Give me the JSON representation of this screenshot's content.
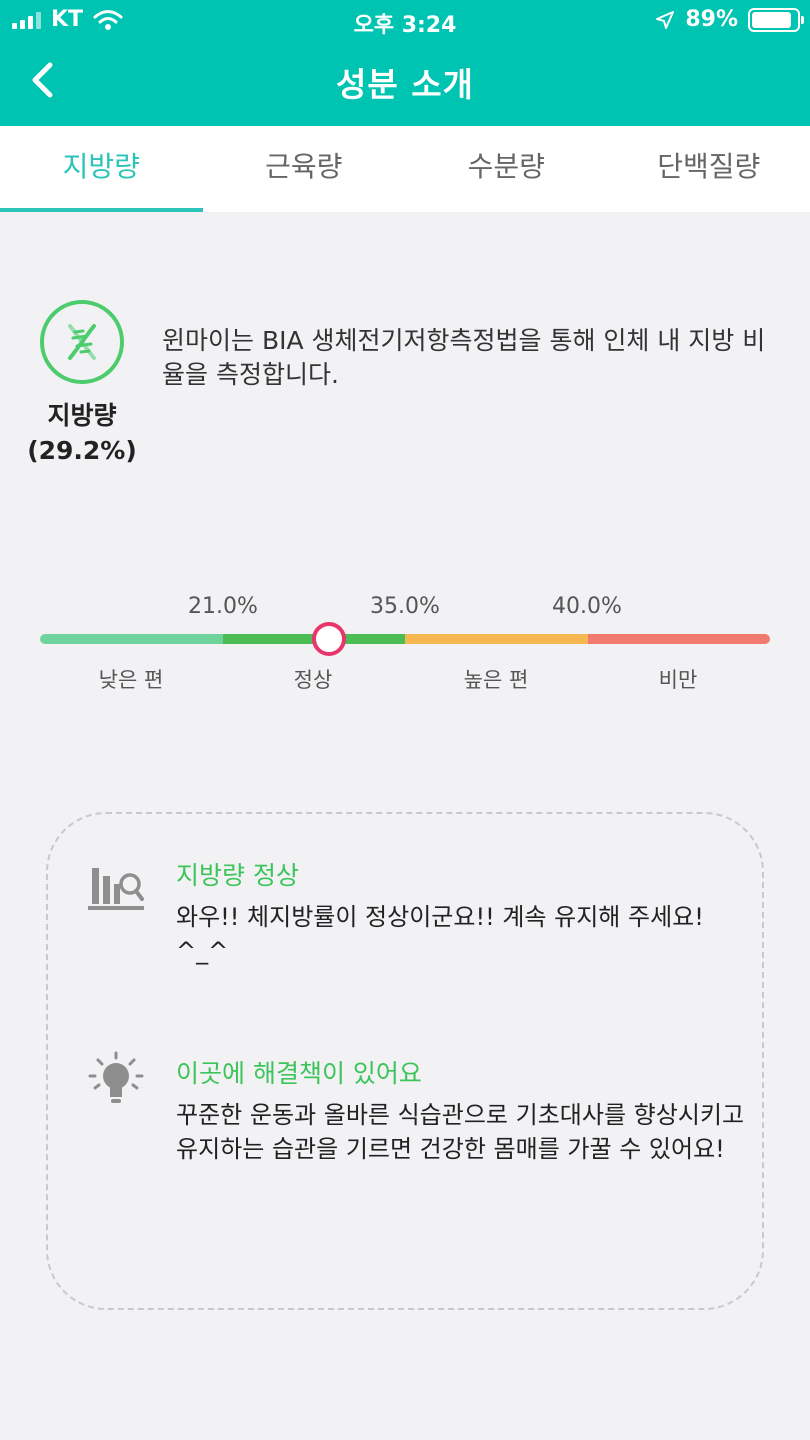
{
  "status": {
    "carrier": "KT",
    "time": "오후 3:24",
    "battery": "89%",
    "battery_level": 0.89
  },
  "nav": {
    "title": "성분 소개",
    "back_icon": "chevron-left-icon"
  },
  "tabs": [
    {
      "label": "지방량",
      "active": true
    },
    {
      "label": "근육량",
      "active": false
    },
    {
      "label": "수분량",
      "active": false
    },
    {
      "label": "단백질량",
      "active": false
    }
  ],
  "metric": {
    "icon": "dna-icon",
    "name": "지방량",
    "value": "(29.2%)",
    "description": "윈마이는 BIA 생체전기저항측정법을 통해 인체 내 지방 비율을 측정합니다."
  },
  "scale": {
    "thresholds": [
      "21.0%",
      "35.0%",
      "40.0%"
    ],
    "ranges": [
      "낮은 편",
      "정상",
      "높은 편",
      "비만"
    ],
    "colors": [
      "#6fd49b",
      "#4cbd55",
      "#f7b851",
      "#f07b6e"
    ],
    "marker_color": "#e8356b",
    "current_value": 29.2
  },
  "card": {
    "status_icon": "chart-magnifier-icon",
    "status_title": "지방량 정상",
    "status_text": "와우!! 체지방률이 정상이군요!! 계속 유지해 주세요! ^_^",
    "tip_icon": "lightbulb-icon",
    "tip_title": "이곳에 해결책이 있어요",
    "tip_text": "꾸준한 운동과 올바른 식습관으로 기초대사를 향상시키고 유지하는 습관을 기르면 건강한 몸매를 가꿀 수 있어요!"
  },
  "colors": {
    "brand": "#00c4b2",
    "accent_tab": "#2cc4b8",
    "green": "#3dc45a"
  }
}
